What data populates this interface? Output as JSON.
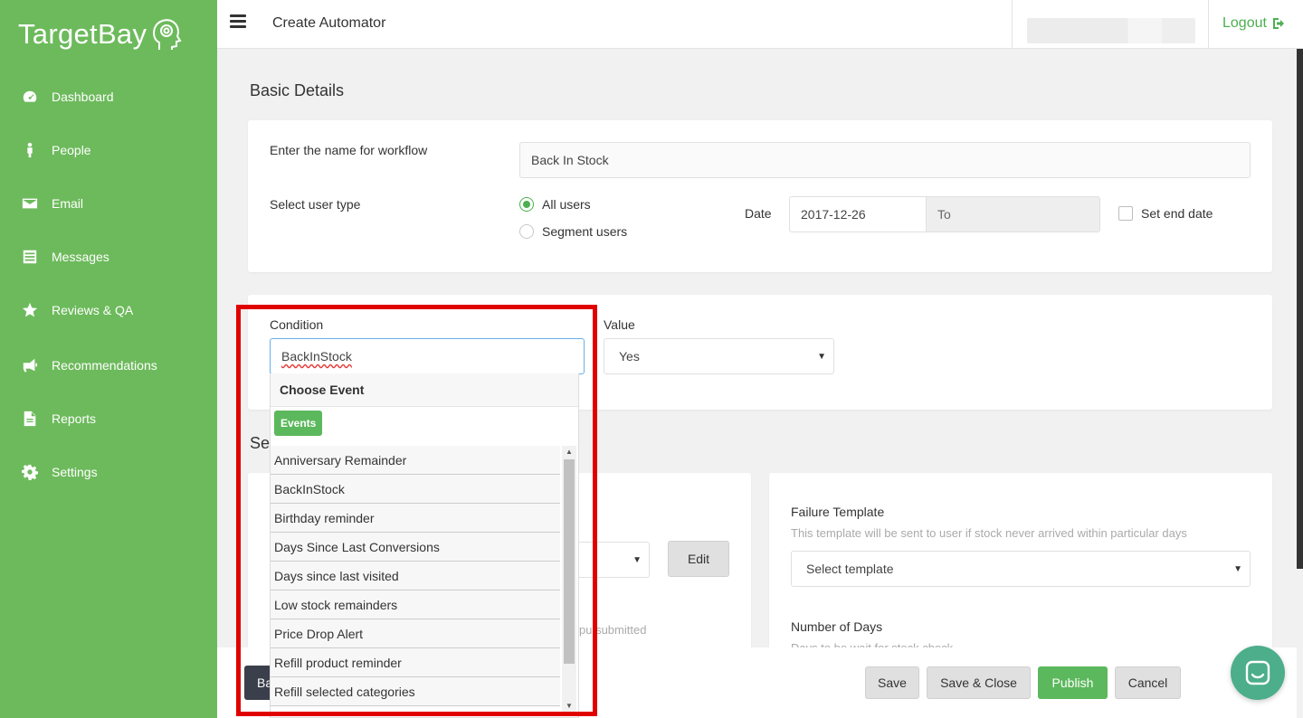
{
  "brand": {
    "name": "TargetBay"
  },
  "colors": {
    "sidebar": "#6dba5c",
    "accent": "#4caf50",
    "highlight": "#e00000"
  },
  "sidebar": {
    "items": [
      {
        "label": "Dashboard",
        "icon": "dashboard-icon"
      },
      {
        "label": "People",
        "icon": "person-icon"
      },
      {
        "label": "Email",
        "icon": "envelope-icon"
      },
      {
        "label": "Messages",
        "icon": "messages-icon"
      },
      {
        "label": "Reviews & QA",
        "icon": "star-icon"
      },
      {
        "label": "Recommendations",
        "icon": "megaphone-icon"
      },
      {
        "label": "Reports",
        "icon": "document-icon"
      },
      {
        "label": "Settings",
        "icon": "gear-icon"
      }
    ]
  },
  "topbar": {
    "title": "Create Automator",
    "logout": "Logout"
  },
  "basic": {
    "title": "Basic Details",
    "name_label": "Enter the name for workflow",
    "name_value": "Back In Stock",
    "user_type_label": "Select user type",
    "all_users": "All users",
    "segment_users": "Segment users",
    "date_label": "Date",
    "date_value": "2017-12-26",
    "to_placeholder": "To",
    "end_date_label": "Set end date"
  },
  "condition": {
    "label": "Condition",
    "value": "BackInStock",
    "value_label": "Value",
    "value_selected": "Yes"
  },
  "dropdown": {
    "header": "Choose Event",
    "badge": "Events",
    "items": [
      "Anniversary Remainder",
      "BackInStock",
      "Birthday reminder",
      "Days Since Last Conversions",
      "Days since last visited",
      "Low stock remainders",
      "Price Drop Alert",
      "Refill product reminder",
      "Refill selected categories"
    ]
  },
  "lower": {
    "section_partial": "Se",
    "edit": "Edit",
    "submitted_partial": "pu submitted",
    "failure_title": "Failure Template",
    "failure_hint": "This template will be sent to user if stock never arrived within particular days",
    "failure_select": "Select template",
    "days_title": "Number of Days",
    "days_hint": "Days to be wait for stock check"
  },
  "footer": {
    "back_partial": "Ba",
    "save": "Save",
    "save_close": "Save & Close",
    "publish": "Publish",
    "cancel": "Cancel"
  }
}
